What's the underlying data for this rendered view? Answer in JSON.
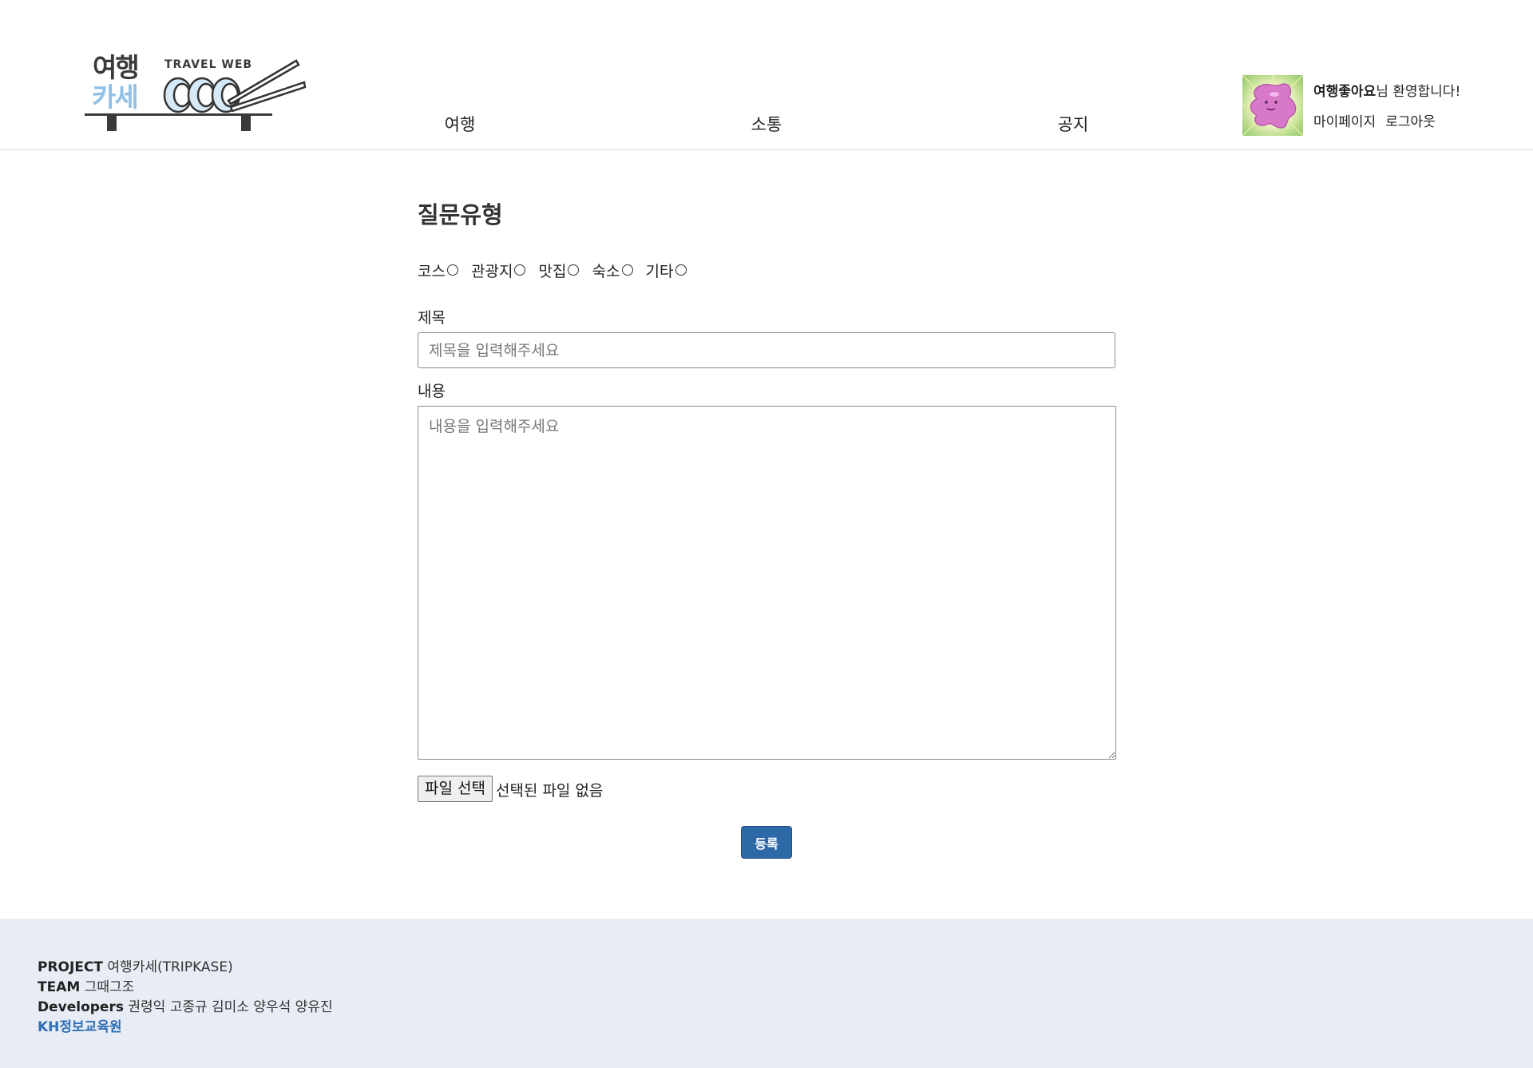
{
  "header": {
    "logo": {
      "line1": "여행",
      "line2": "카세",
      "tagline": "TRAVEL WEB"
    },
    "nav": [
      {
        "label": "여행"
      },
      {
        "label": "소통"
      },
      {
        "label": "공지"
      }
    ],
    "user": {
      "name": "여행좋아요",
      "welcome_suffix": "님 환영합니다!",
      "mypage_label": "마이페이지",
      "logout_label": "로그아웃"
    }
  },
  "form": {
    "title": "질문유형",
    "radio_options": [
      {
        "label": "코스"
      },
      {
        "label": "관광지"
      },
      {
        "label": "맛집"
      },
      {
        "label": "숙소"
      },
      {
        "label": "기타"
      }
    ],
    "subject_label": "제목",
    "subject_placeholder": "제목을 입력해주세요",
    "content_label": "내용",
    "content_placeholder": "내용을 입력해주세요",
    "file_button_label": "파일 선택",
    "file_status": "선택된 파일 없음",
    "submit_label": "등록"
  },
  "footer": {
    "project_key": "PROJECT",
    "project_value": "여행카세(TRIPKASE)",
    "team_key": "TEAM",
    "team_value": "그때그조",
    "developers_key": "Developers",
    "developers_value": "권령익 고종규 김미소 양우석 양유진",
    "academy_link": "KH정보교육원"
  },
  "colors": {
    "accent": "#2d69a6",
    "footer_bg": "#e8ecf4",
    "footer_link": "#2e6fb6",
    "logo_dark": "#3a3a3a",
    "logo_light": "#8fc0e8"
  }
}
